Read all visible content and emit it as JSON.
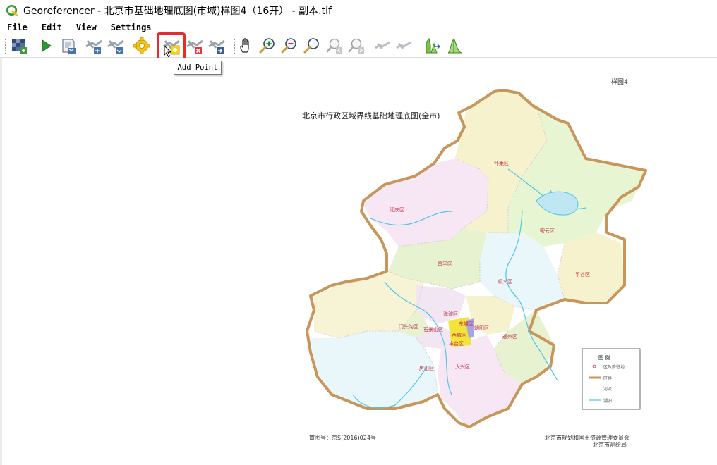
{
  "window": {
    "title": "Georeferencer - 北京市基础地理底图(市域)样图4（16开） - 副本.tif"
  },
  "menu": {
    "items": [
      "File",
      "Edit",
      "View",
      "Settings"
    ]
  },
  "toolbar": {
    "buttons": [
      {
        "name": "open-raster",
        "icon": "open-raster-icon"
      },
      {
        "name": "start-georeferencing",
        "icon": "play-icon"
      },
      {
        "name": "generate-gdal-script",
        "icon": "script-icon"
      },
      {
        "name": "load-gcp-points",
        "icon": "load-gcp-icon"
      },
      {
        "name": "save-gcp-points",
        "icon": "save-gcp-icon"
      },
      {
        "name": "transformation-settings",
        "icon": "gear-icon"
      },
      {
        "name": "add-point",
        "icon": "add-point-icon"
      },
      {
        "name": "delete-point",
        "icon": "delete-point-icon"
      },
      {
        "name": "move-gcp-point",
        "icon": "move-point-icon"
      },
      {
        "name": "pan",
        "icon": "hand-icon"
      },
      {
        "name": "zoom-in",
        "icon": "zoom-in-icon"
      },
      {
        "name": "zoom-out",
        "icon": "zoom-out-icon"
      },
      {
        "name": "zoom-to-layer",
        "icon": "zoom-layer-icon"
      },
      {
        "name": "zoom-last",
        "icon": "zoom-last-icon"
      },
      {
        "name": "zoom-next",
        "icon": "zoom-next-icon"
      },
      {
        "name": "link-georeferencer-to-qgis",
        "icon": "link-qgis-icon"
      },
      {
        "name": "link-qgis-to-georeferencer",
        "icon": "link-georef-icon"
      },
      {
        "name": "full-histogram-stretch",
        "icon": "histogram-full-icon"
      },
      {
        "name": "local-histogram-stretch",
        "icon": "histogram-local-icon"
      }
    ],
    "tooltip": "Add Point"
  },
  "map": {
    "sheet_number": "样图4",
    "title": "北京市行政区域界线基础地理底图(全市)",
    "review_number": "审图号：京S(2016)024号",
    "publisher_line1": "北京市规划和国土资源管理委员会",
    "publisher_line2": "北京市测绘局",
    "legend_title": "图   例",
    "legend_items": [
      "区政府驻地",
      "区界",
      "河流",
      "湖泊"
    ],
    "district_labels": [
      "延庆区",
      "怀柔区",
      "密云区",
      "平谷区",
      "昌平区",
      "顺义区",
      "门头沟区",
      "海淀区",
      "朝阳区",
      "石景山区",
      "丰台区",
      "通州区",
      "房山区",
      "大兴区",
      "东城区",
      "西城区"
    ]
  },
  "colors": {
    "accent_highlight": "#e8292f",
    "boundary": "#c8955a",
    "river": "#4bc6e6"
  }
}
